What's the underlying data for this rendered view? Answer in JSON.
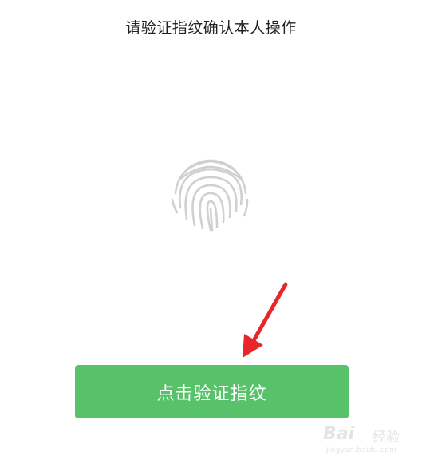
{
  "prompt": {
    "title": "请验证指纹确认本人操作"
  },
  "fingerprint": {
    "icon": "fingerprint-icon",
    "color": "#d0d0d0"
  },
  "annotation": {
    "icon": "red-arrow-icon",
    "color": "#e8262a"
  },
  "verify_button": {
    "label": "点击验证指纹",
    "color": "#58c26a"
  },
  "watermark": {
    "brand": "Bai",
    "brand_cn": "经验",
    "url": "jingyan.baidu.com"
  }
}
